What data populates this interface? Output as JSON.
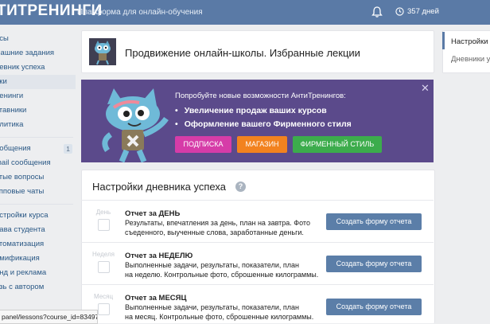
{
  "topbar": {
    "brand": "ТИТРЕНИНГИ",
    "tagline": "Платформа для онлайн-обучения",
    "days": "357 дней"
  },
  "sidebar": {
    "items": [
      {
        "label": "рсы"
      },
      {
        "label": "машние задания"
      },
      {
        "label": "невник успеха"
      },
      {
        "label": "оки"
      },
      {
        "label": "ренинги"
      },
      {
        "label": "ставники"
      },
      {
        "label": "алитика"
      },
      {
        "label": "ообщения",
        "badge": "1"
      },
      {
        "label": "mail сообщения"
      },
      {
        "label": "стые вопросы"
      },
      {
        "label": "упповые чаты"
      },
      {
        "label": "астройки курса"
      },
      {
        "label": "рава студента"
      },
      {
        "label": "втоматизация"
      },
      {
        "label": "ймификация"
      },
      {
        "label": "енд и реклама"
      },
      {
        "label": "язь с автором"
      }
    ]
  },
  "header": {
    "title": "Продвижение онлайн-школы. Избранные лекции"
  },
  "promo": {
    "headline": "Попробуйте новые возможности АнтиТренингов:",
    "bullets": [
      "Увеличение продаж ваших курсов",
      "Оформление вашего Фирменного стиля"
    ],
    "buttons": [
      {
        "label": "ПОДПИСКА",
        "color": "#d63ca8"
      },
      {
        "label": "МАГАЗИН",
        "color": "#f2821f"
      },
      {
        "label": "ФИРМЕННЫЙ СТИЛЬ",
        "color": "#3cac4c"
      }
    ],
    "close": "✕"
  },
  "settings": {
    "title": "Настройки дневника успеха",
    "help": "?",
    "reports": [
      {
        "icon_label": "День",
        "title": "Отчет за ДЕНЬ",
        "line1": "Результаты, впечатления за день, план на завтра. Фото",
        "line2": "съеденного, выученные слова, заработанные деньги.",
        "button": "Создать форму отчета"
      },
      {
        "icon_label": "Неделя",
        "title": "Отчет за НЕДЕЛЮ",
        "line1": "Выполненные задачи, результаты, показатели, план",
        "line2": "на неделю. Контрольные фото, сброшенные килограммы.",
        "button": "Создать форму отчета"
      },
      {
        "icon_label": "Месяц",
        "title": "Отчет за МЕСЯЦ",
        "line1": "Выполненные задачи, результаты, показатели, план",
        "line2": "на месяц. Контрольные фото, сброшенные килограммы.",
        "button": "Создать форму отчета"
      }
    ]
  },
  "right_nav": {
    "items": [
      "Настройки",
      "Дневники у"
    ]
  },
  "status_bar": {
    "url": "panel/lessons?course_id=83497"
  }
}
